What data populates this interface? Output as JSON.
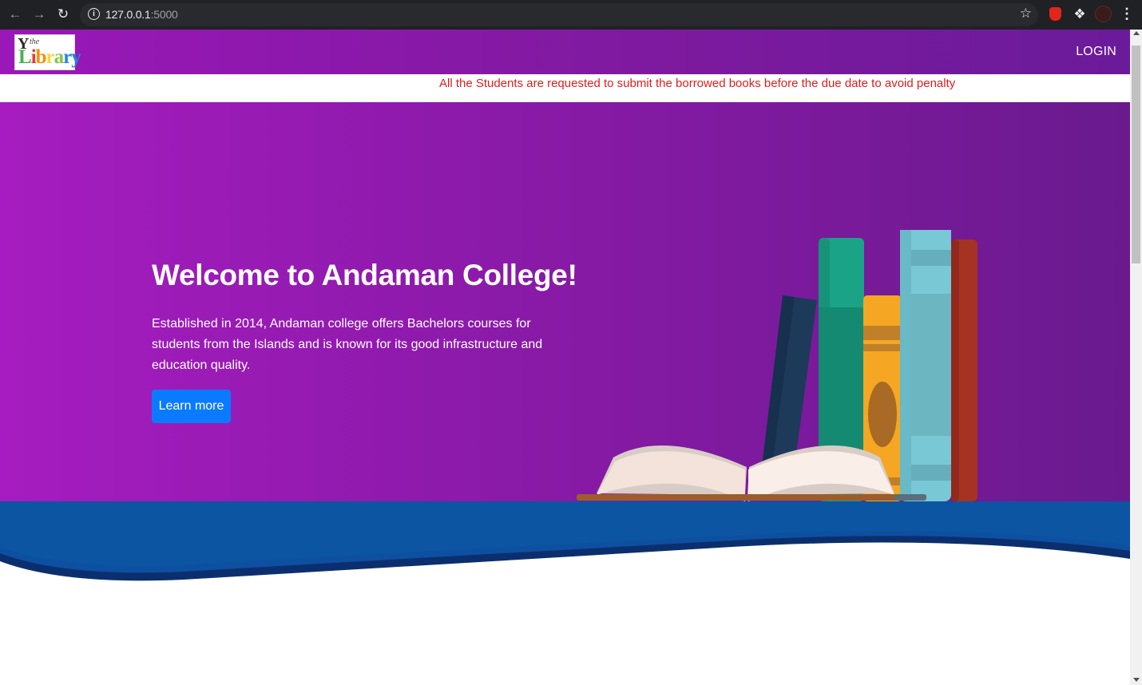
{
  "browser": {
    "url_host": "127.0.0.1",
    "url_port": ":5000"
  },
  "navbar": {
    "logo": {
      "small_text": "the",
      "word": "Library"
    },
    "login_label": "LOGIN"
  },
  "notice": {
    "text": "All the Students are requested to submit the borrowed books before the due date to avoid penalty"
  },
  "hero": {
    "title": "Welcome to Andaman College!",
    "description": "Established in 2014, Andaman college offers Bachelors courses for students from the Islands and is known for its good infrastructure and education quality.",
    "button_label": "Learn more"
  },
  "colors": {
    "hero_gradient_start": "#a61cc0",
    "hero_gradient_end": "#6a1a8e",
    "notice_text": "#e31b1b",
    "button": "#0a7bff",
    "wave": "#0d4fa0"
  },
  "icons": [
    "back-arrow-icon",
    "forward-arrow-icon",
    "reload-icon",
    "info-icon",
    "star-icon",
    "extension-icon",
    "puzzle-icon",
    "profile-icon",
    "menu-dots-icon",
    "books-illustration"
  ]
}
